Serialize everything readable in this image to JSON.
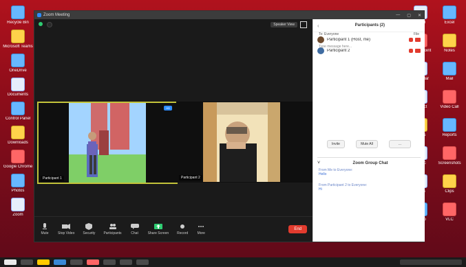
{
  "desktop": {
    "left": [
      {
        "label": "Recycle Bin"
      },
      {
        "label": "Microsoft Teams"
      },
      {
        "label": "OneDrive"
      },
      {
        "label": "Documents"
      },
      {
        "label": "Control Panel"
      },
      {
        "label": "Downloads"
      },
      {
        "label": "Google Chrome"
      },
      {
        "label": "Photos"
      },
      {
        "label": "Zoom"
      }
    ],
    "right": [
      {
        "label": "Word"
      },
      {
        "label": "Excel"
      },
      {
        "label": "PowerPoint"
      },
      {
        "label": "Notes"
      },
      {
        "label": "Calendar"
      },
      {
        "label": "Mail"
      },
      {
        "label": "Project"
      },
      {
        "label": "Video Call"
      },
      {
        "label": "Class"
      },
      {
        "label": "Reports"
      },
      {
        "label": "Music"
      },
      {
        "label": "Screenshots"
      },
      {
        "label": "Docs"
      },
      {
        "label": "Clips"
      },
      {
        "label": "Setup"
      },
      {
        "label": "VLC"
      }
    ],
    "colors": {
      "wallpaper_top": "#b0121d",
      "wallpaper_bottom": "#5f0a19"
    }
  },
  "zoom": {
    "title": "Zoom Meeting",
    "speaker_view": "Speaker View",
    "tiles": [
      {
        "name": "Participant 1"
      },
      {
        "name": "Participant 2"
      }
    ],
    "toolbar": [
      {
        "label": "Mute"
      },
      {
        "label": "Stop Video"
      },
      {
        "label": "Security"
      },
      {
        "label": "Participants"
      },
      {
        "label": "Chat"
      },
      {
        "label": "Share Screen"
      },
      {
        "label": "Record"
      },
      {
        "label": "More"
      }
    ],
    "end": "End",
    "panel": {
      "title": "Participants (2)",
      "participants": [
        {
          "name": "Participant 1 (Host, me)"
        },
        {
          "name": "Participant 2"
        }
      ],
      "buttons": {
        "invite": "Invite",
        "mute_all": "Mute All",
        "more": "..."
      },
      "chat_title": "Zoom Group Chat",
      "messages": [
        {
          "from": "From Me to Everyone:",
          "text": "Hello"
        },
        {
          "from": "From Participant 2 to Everyone:",
          "text": "Hi"
        }
      ],
      "to": "To: Everyone",
      "file": "File",
      "input_placeholder": "Type message here..."
    }
  }
}
